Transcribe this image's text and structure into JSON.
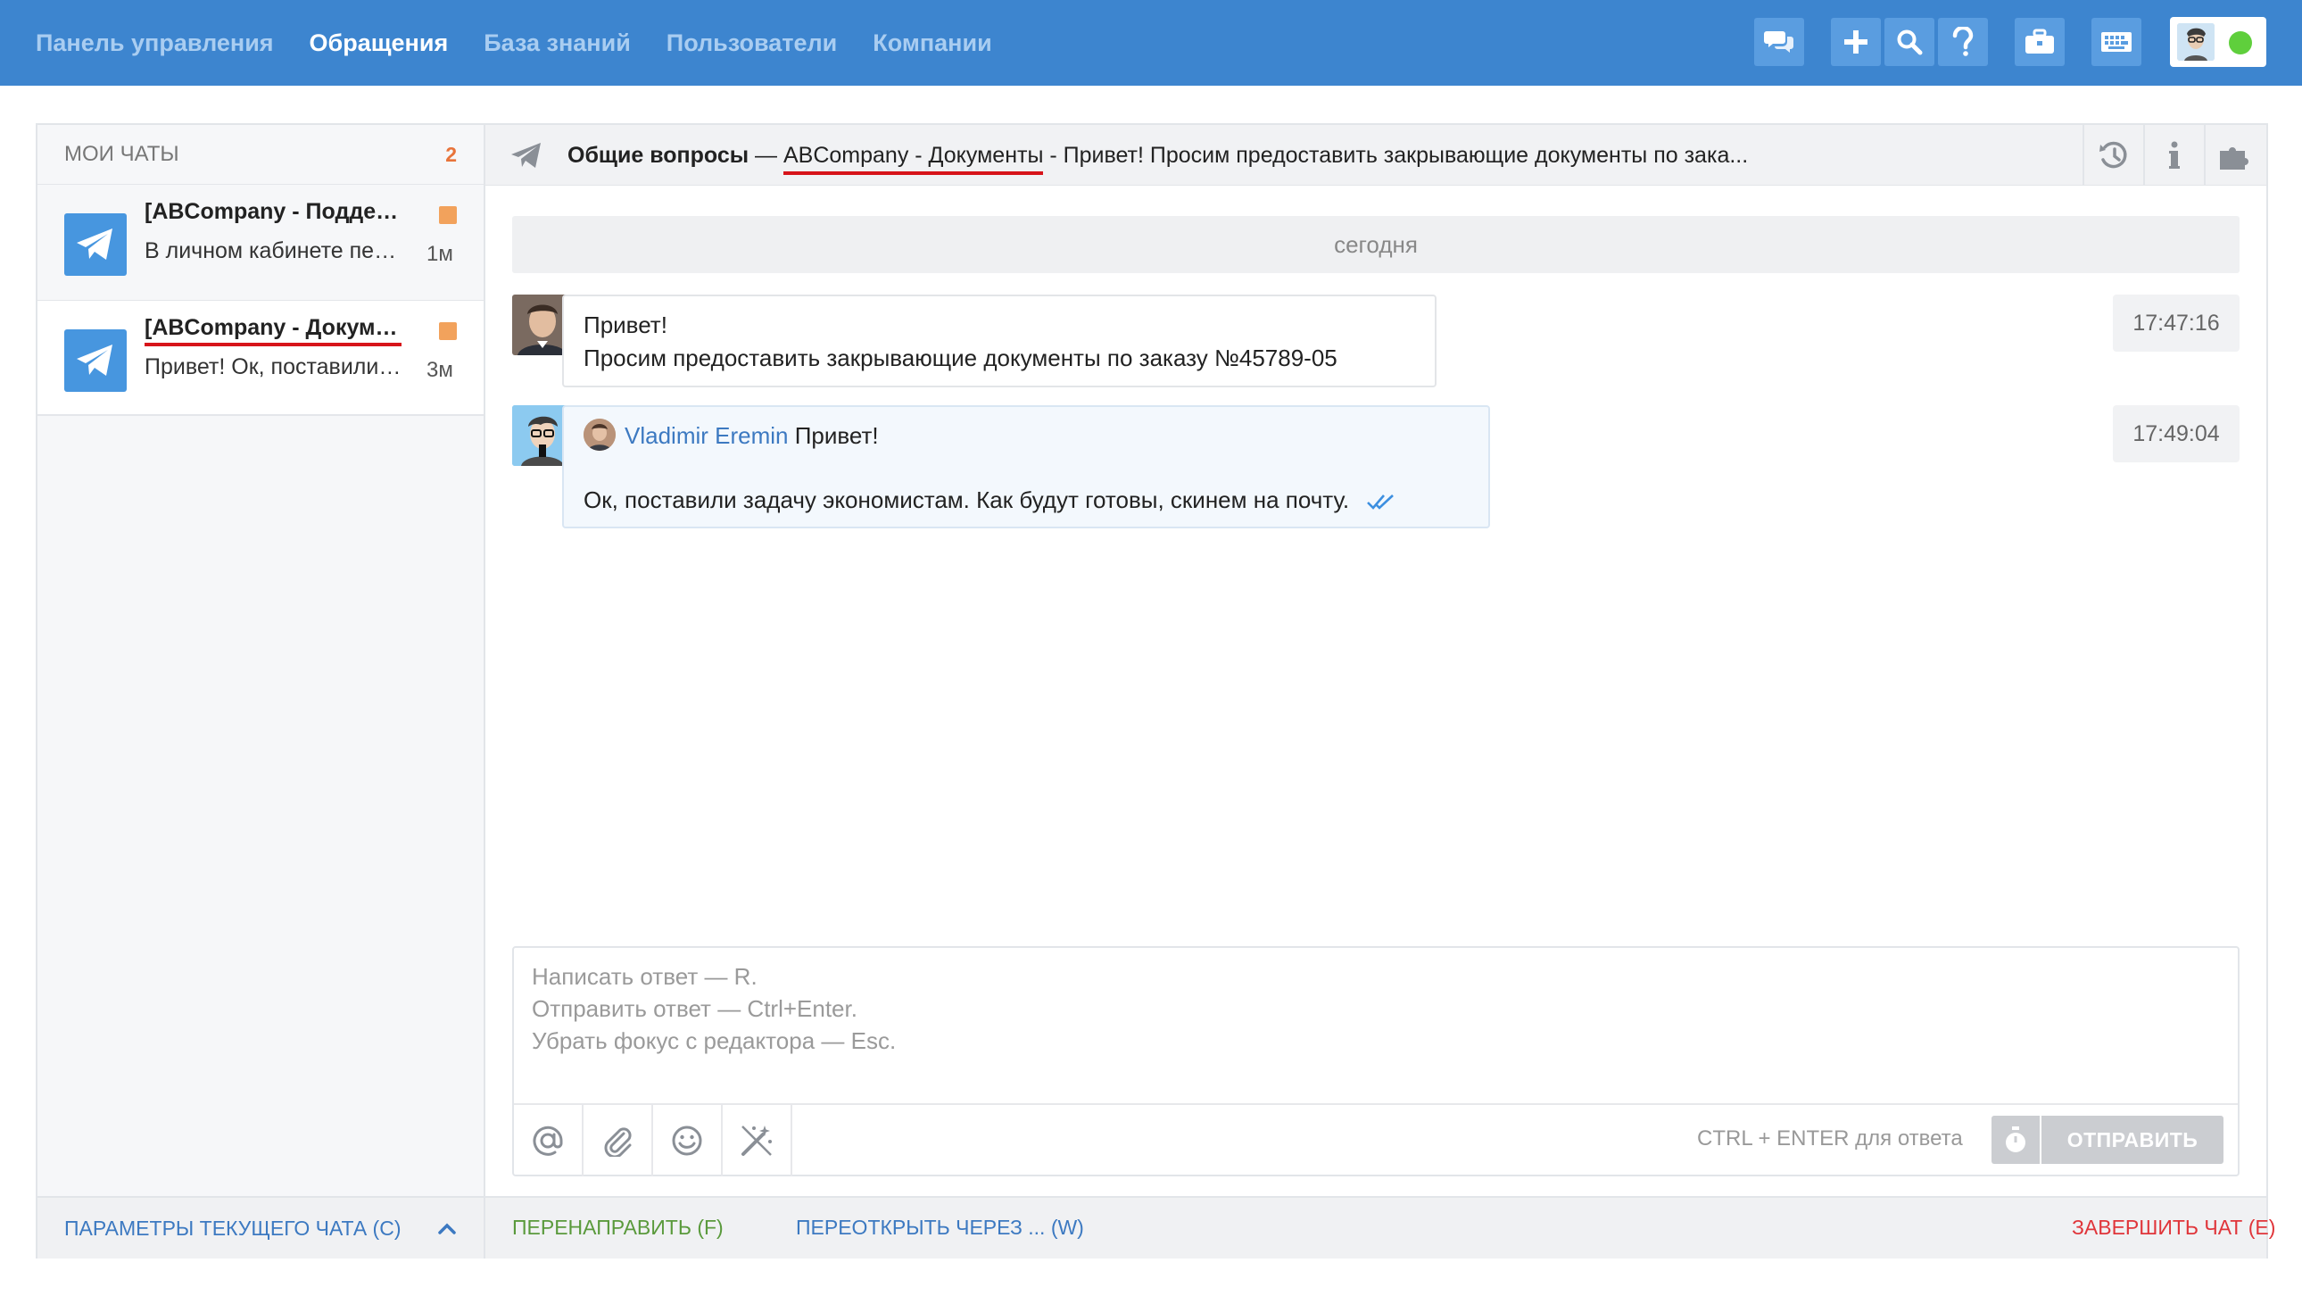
{
  "nav": {
    "items": [
      {
        "label": "Панель управления",
        "active": false
      },
      {
        "label": "Обращения",
        "active": true
      },
      {
        "label": "База знаний",
        "active": false
      },
      {
        "label": "Пользователи",
        "active": false
      },
      {
        "label": "Компании",
        "active": false
      }
    ]
  },
  "colors": {
    "topbar": "#3d85cf",
    "accent_link": "#3c79c1",
    "redirect_green": "#5a9a3c",
    "close_red": "#e0353a",
    "unread_orange": "#e8733a",
    "online_green": "#5fcf3c",
    "underline_red": "#d7141a"
  },
  "sidebar": {
    "header_label": "МОИ ЧАТЫ",
    "count": "2",
    "chats": [
      {
        "title": "[ABCompany - Поддержка]",
        "preview": "В личном кабинете перестала работать выгрузка",
        "time": "1м",
        "icon": "telegram-icon"
      },
      {
        "title": "[ABCompany - Документы]",
        "preview": "Привет! Ок, поставили задачу экономистам",
        "time": "3м",
        "icon": "telegram-icon"
      }
    ],
    "footer_label": "ПАРАМЕТРЫ ТЕКУЩЕГО ЧАТА (C)"
  },
  "chat": {
    "category": "Общие вопросы",
    "separator": " — ",
    "company": "ABCompany - Документы",
    "subject": " - Привет! Просим предоставить закрывающие документы по зака...",
    "date_divider": "сегодня",
    "messages": [
      {
        "lines": [
          "Привет!",
          "Просим предоставить закрывающие документы по заказу №45789-05"
        ],
        "time": "17:47:16"
      },
      {
        "operator_name": "Vladimir Eremin",
        "quote": "Привет!",
        "text": "Ок, поставили задачу экономистам. Как будут готовы, скинем на почту.",
        "time": "17:49:04"
      }
    ]
  },
  "composer": {
    "placeholder": "Написать ответ — R.\nОтправить ответ — Ctrl+Enter.\nУбрать фокус с редактора — Esc.",
    "hint": "CTRL + ENTER для ответа",
    "send_label": "ОТПРАВИТЬ"
  },
  "footer": {
    "redirect": "ПЕРЕНАПРАВИТЬ (F)",
    "reopen": "ПЕРЕОТКРЫТЬ ЧЕРЕЗ ... (W)",
    "close": "ЗАВЕРШИТЬ ЧАТ (E)"
  }
}
